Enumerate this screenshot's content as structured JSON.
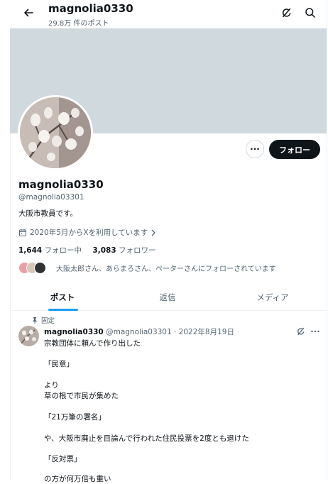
{
  "header": {
    "back_icon": "arrow-left-icon",
    "username": "magnolia0330",
    "post_count": "29.8万 件のポスト",
    "grok_icon": "grok-icon",
    "search_icon": "search-icon"
  },
  "profile": {
    "display_name": "magnolia0330",
    "handle": "@magnolia03301",
    "bio": "大阪市教員です。",
    "joined": "2020年5月からXを利用しています",
    "following_count": "1,644",
    "following_label": "フォロー中",
    "followers_count": "3,083",
    "followers_label": "フォロワー",
    "followed_by": "大阪太郎さん、あらまろさん、ペーターさんにフォローされています",
    "more_label": "···",
    "follow_label": "フォロー"
  },
  "tabs": [
    "ポスト",
    "返信",
    "メディア"
  ],
  "pinned_tweet": {
    "pinned_label": "固定",
    "name": "magnolia0330",
    "handle_date": "@magnolia03301 · 2022年8月19日",
    "lines": [
      "宗教団体に頼んで作り出した",
      "「民意」",
      "より",
      "草の根で市民が集めた",
      "「21万筆の署名」",
      "や、大阪市廃止を目論んで行われた住民投票を2度とも退けた",
      "「反対票」",
      "の方が何万倍も重い"
    ]
  },
  "colors": {
    "accent": "#1d9bf0",
    "banner": "#cfd9de",
    "text": "#0f1419",
    "secondary": "#536471"
  }
}
